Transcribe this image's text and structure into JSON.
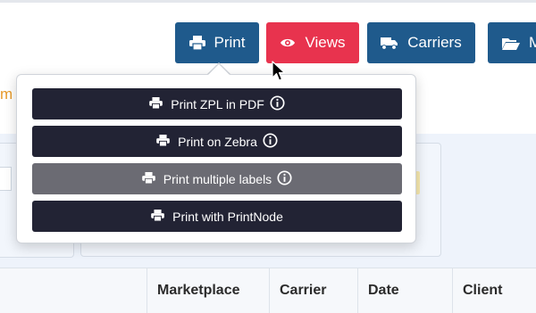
{
  "toolbar": {
    "print_label": "Print",
    "views_label": "Views",
    "carriers_label": "Carriers",
    "more_label": "M",
    "colors": {
      "primary": "#1f5a8c",
      "views": "#e8334e"
    }
  },
  "background_fragment": "m",
  "print_menu": {
    "items": [
      {
        "label": "Print ZPL in PDF",
        "info_icon": true
      },
      {
        "label": "Print on Zebra",
        "info_icon": true
      },
      {
        "label": "Print multiple labels",
        "info_icon": true,
        "highlighted": true
      },
      {
        "label": "Print with PrintNode",
        "info_icon": false
      }
    ],
    "colors": {
      "item": "#222334",
      "hover": "#6b6b73"
    }
  },
  "table": {
    "headers": [
      "Marketplace",
      "Carrier",
      "Date",
      "Client"
    ]
  }
}
